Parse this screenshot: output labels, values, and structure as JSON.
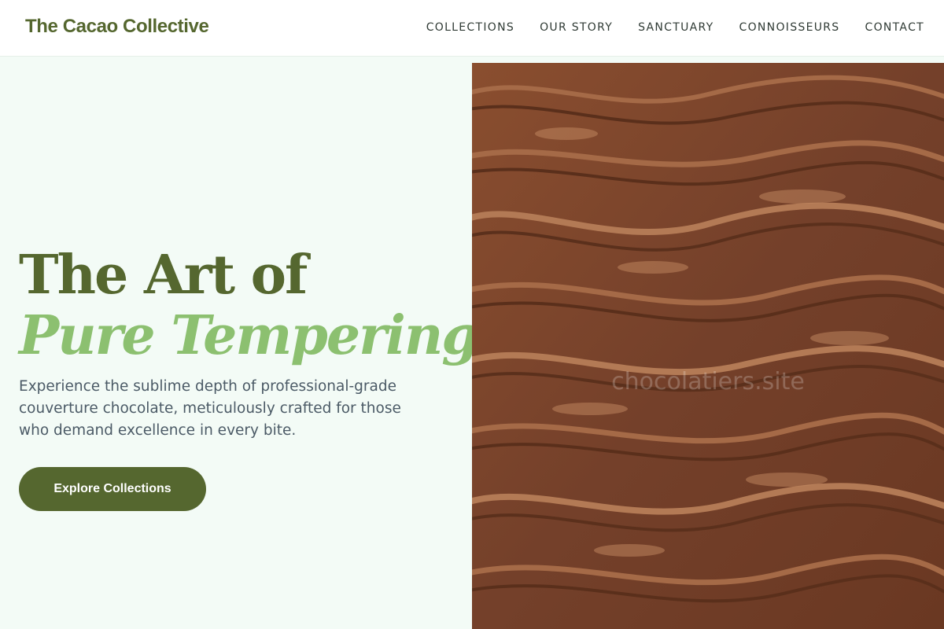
{
  "header": {
    "brand": "The Cacao Collective",
    "nav": [
      {
        "label": "COLLECTIONS"
      },
      {
        "label": "OUR STORY"
      },
      {
        "label": "SANCTUARY"
      },
      {
        "label": "CONNOISSEURS"
      },
      {
        "label": "CONTACT"
      }
    ]
  },
  "hero": {
    "title_line1": "The Art of",
    "title_line2": "Pure Tempering",
    "subtitle": "Experience the sublime depth of professional-grade couverture chocolate, meticulously crafted for those who demand excellence in every bite.",
    "cta_label": "Explore Collections",
    "image_watermark": "chocolatiers.site"
  },
  "colors": {
    "brand_green": "#55672f",
    "accent_green": "#8cc070",
    "page_background": "#f3fbf6",
    "chocolate": "#7a4327"
  }
}
